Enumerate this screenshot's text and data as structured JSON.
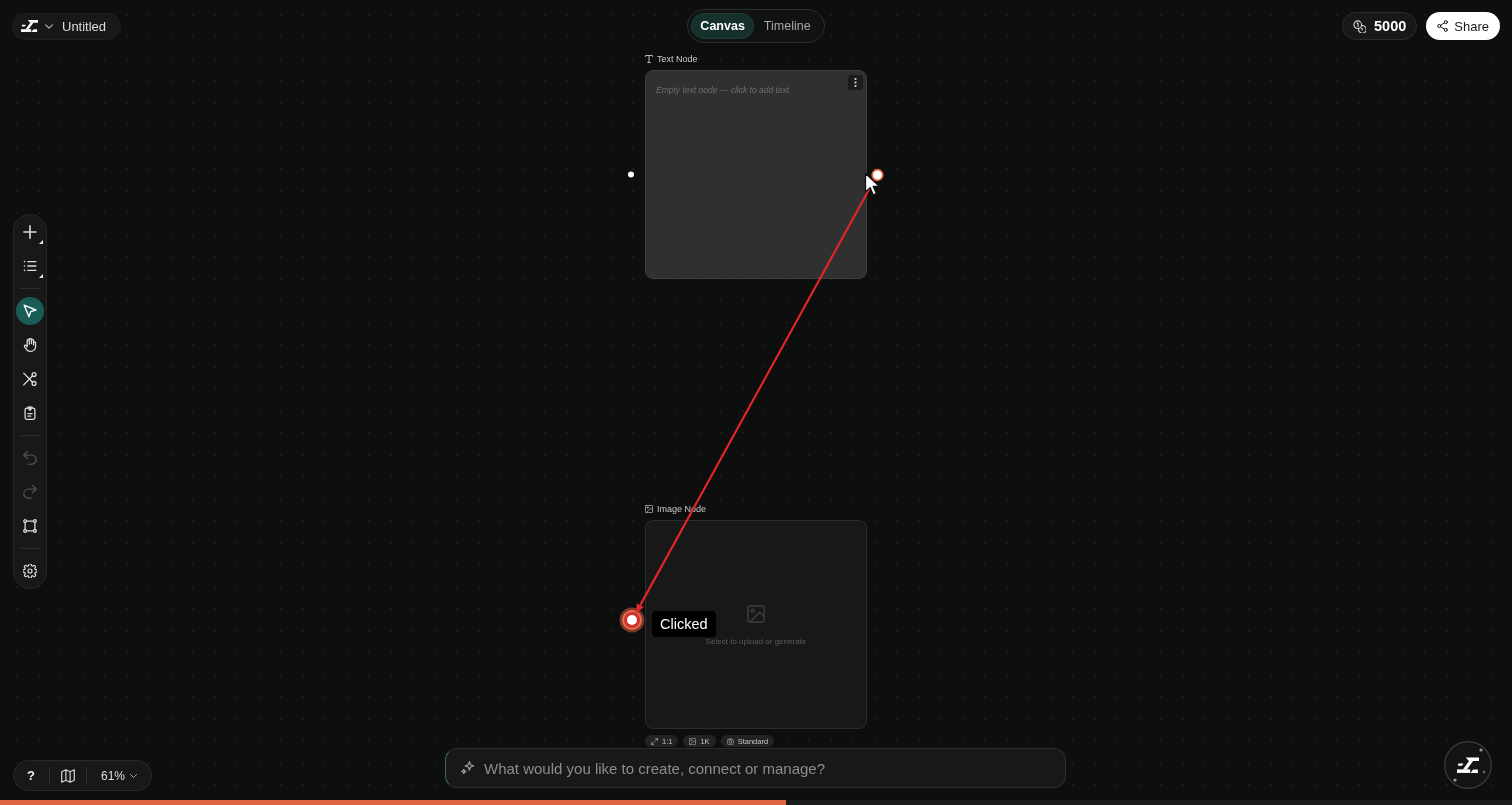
{
  "header": {
    "project": {
      "title": "Untitled"
    },
    "view_tabs": [
      {
        "label": "Canvas",
        "selected": true
      },
      {
        "label": "Timeline",
        "selected": false
      }
    ],
    "credits": "5000",
    "share": "Share"
  },
  "toolbar": {
    "groups": [
      [
        {
          "kind": "add",
          "submenu": true,
          "selected": false,
          "disabled": false
        },
        {
          "kind": "list",
          "submenu": true,
          "selected": false,
          "disabled": false
        }
      ],
      [
        {
          "kind": "select",
          "submenu": false,
          "selected": true,
          "disabled": false
        },
        {
          "kind": "pan",
          "submenu": false,
          "selected": false,
          "disabled": false
        },
        {
          "kind": "connect",
          "submenu": false,
          "selected": false,
          "disabled": false
        },
        {
          "kind": "paste",
          "submenu": false,
          "selected": false,
          "disabled": false
        }
      ],
      [
        {
          "kind": "undo",
          "submenu": false,
          "selected": false,
          "disabled": true
        },
        {
          "kind": "redo",
          "submenu": false,
          "selected": false,
          "disabled": true
        },
        {
          "kind": "frame",
          "submenu": false,
          "selected": false,
          "disabled": false
        }
      ],
      [
        {
          "kind": "settings",
          "submenu": false,
          "selected": false,
          "disabled": false
        }
      ]
    ]
  },
  "canvas": {
    "nodes": [
      {
        "kind": "text",
        "title": "Text Node",
        "placeholder": "Empty text node — click to add text"
      },
      {
        "kind": "image",
        "title": "Image Node",
        "hint": "Select to upload or generate",
        "options": [
          {
            "kind": "aspect",
            "label": "1:1"
          },
          {
            "kind": "resolution",
            "label": "1K"
          },
          {
            "kind": "quality",
            "label": "Standard"
          }
        ]
      }
    ],
    "connection": {
      "tooltip": "Clicked"
    }
  },
  "view_controls": {
    "help": "?",
    "zoom": "61%"
  },
  "prompt": {
    "placeholder": "What would you like to create, connect or manage?"
  },
  "progress": {
    "level": 0.52
  }
}
